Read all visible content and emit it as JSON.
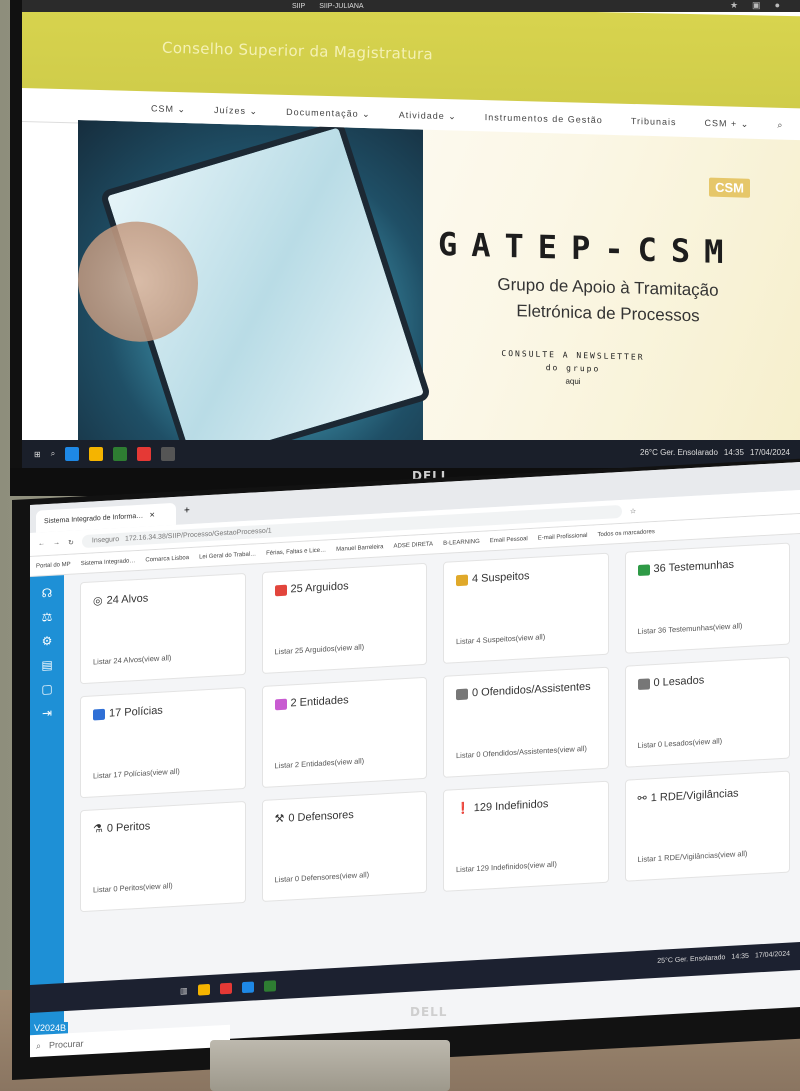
{
  "top_screen": {
    "tabs": [
      "SIIP",
      "SIIP-JULIANA"
    ],
    "site_title": "Conselho Superior da Magistratura",
    "nav": [
      "CSM ⌄",
      "Juízes ⌄",
      "Documentação ⌄",
      "Atividade ⌄",
      "Instrumentos de Gestão",
      "Tribunais",
      "CSM + ⌄"
    ],
    "hero": {
      "logo": "CSM",
      "title": "GATEP-CSM",
      "subtitle_line1": "Grupo de Apoio à Tramitação",
      "subtitle_line2": "Eletrónica de Processos",
      "news_line1": "CONSULTE A NEWSLETTER",
      "news_line2": "do grupo",
      "news_link": "aqui"
    },
    "tray": {
      "weather": "26°C  Ger. Ensolarado",
      "time": "14:35",
      "date": "17/04/2024"
    }
  },
  "brand": "DELL",
  "bottom_screen": {
    "tab_title": "Sistema Integrado de Informa…",
    "security": "Inseguro",
    "url": "172.16.34.38/SIIP/Processo/GestaoProcesso/1",
    "bookmarks": [
      "Portal do MP",
      "Sistema Integrado…",
      "Comarca Lisboa",
      "Lei Geral do Trabal…",
      "Férias, Faltas e Lice…",
      "Manuel Barreleira",
      "ADSE DIRETA",
      "B-LEARNING",
      "Email Pessoal",
      "E-mail Profissional",
      "Todos os marcadores"
    ],
    "cards": [
      {
        "title": "24 Alvos",
        "link": "Listar 24 Alvos(view all)",
        "color": "#222222"
      },
      {
        "title": "25 Arguidos",
        "link": "Listar 25 Arguidos(view all)",
        "color": "#e2453c"
      },
      {
        "title": "4 Suspeitos",
        "link": "Listar 4 Suspeitos(view all)",
        "color": "#e0a92a"
      },
      {
        "title": "36 Testemunhas",
        "link": "Listar 36 Testemunhas(view all)",
        "color": "#2e9a46"
      },
      {
        "title": "17 Polícias",
        "link": "Listar 17 Polícias(view all)",
        "color": "#2f6fd6"
      },
      {
        "title": "2 Entidades",
        "link": "Listar 2 Entidades(view all)",
        "color": "#c85bd1"
      },
      {
        "title": "0 Ofendidos/Assistentes",
        "link": "Listar 0 Ofendidos/Assistentes(view all)",
        "color": "#777777"
      },
      {
        "title": "0 Lesados",
        "link": "Listar 0 Lesados(view all)",
        "color": "#777777"
      },
      {
        "title": "0 Peritos",
        "link": "Listar 0 Peritos(view all)",
        "color": "#222222"
      },
      {
        "title": "0 Defensores",
        "link": "Listar 0 Defensores(view all)",
        "color": "#222222"
      },
      {
        "title": "129 Indefinidos",
        "link": "Listar 129 Indefinidos(view all)",
        "color": "#222222"
      },
      {
        "title": "1 RDE/Vigilâncias",
        "link": "Listar 1 RDE/Vigilâncias(view all)",
        "color": "#222222"
      }
    ],
    "tray": {
      "weather": "25°C  Ger. Ensolarado",
      "time": "14:35",
      "date": "17/04/2024"
    },
    "search_placeholder": "Procurar",
    "version": "V2024B"
  }
}
